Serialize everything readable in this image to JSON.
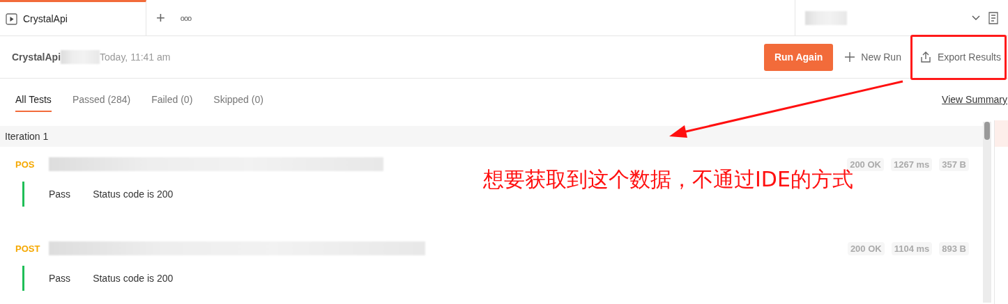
{
  "tab_bar": {
    "tabs": [
      {
        "label": "CrystalApi",
        "selected": true
      }
    ],
    "new_tab": "+",
    "more": "ooo"
  },
  "header": {
    "collection": "CrystalApi",
    "time": "Today, 11:41 am",
    "run_again": "Run Again",
    "new_run": "New Run",
    "export": "Export Results"
  },
  "filters": [
    {
      "label": "All Tests",
      "selected": true
    },
    {
      "label": "Passed (284)",
      "selected": false
    },
    {
      "label": "Failed (0)",
      "selected": false
    },
    {
      "label": "Skipped (0)",
      "selected": false
    }
  ],
  "view_summary": "View Summary",
  "iteration": "Iteration 1",
  "requests": [
    {
      "method": "POS",
      "status": "200 OK",
      "time": "1267 ms",
      "size": "357 B",
      "tests": [
        {
          "result": "Pass",
          "name": "Status code is 200"
        }
      ]
    },
    {
      "method": "POST",
      "status": "200 OK",
      "time": "1104 ms",
      "size": "893 B",
      "tests": [
        {
          "result": "Pass",
          "name": "Status code is 200"
        }
      ]
    }
  ],
  "annotation": {
    "text": "想要获取到这个数据，不通过IDE的方式"
  }
}
